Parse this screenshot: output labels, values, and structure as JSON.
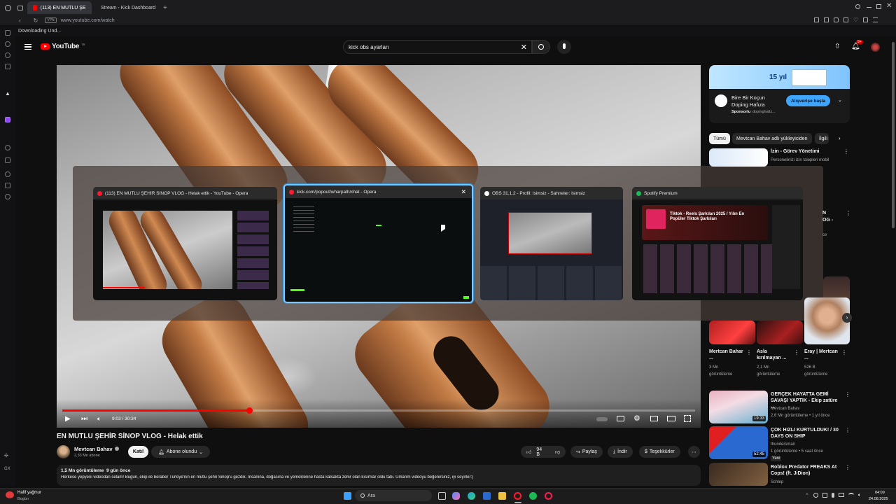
{
  "browser": {
    "tabs": [
      {
        "label": "(113) EN MUTLU ŞEHİR S…",
        "active": true,
        "color": "#ff0000"
      },
      {
        "label": "Stream - Kick Dashboard",
        "active": false,
        "color": "#53fc18"
      }
    ],
    "url": "www.youtube.com/watch",
    "vpn_badge": "VPN",
    "download_text": "Downloading Und..."
  },
  "youtube": {
    "logo_text": "YouTube",
    "logo_region": "TR",
    "search_value": "kick obs ayarları",
    "notification_count": "9+"
  },
  "player": {
    "time": "9:03 / 30:34",
    "progress_fraction": 0.296
  },
  "switcher": {
    "windows": [
      {
        "title": "(113) EN MUTLU ŞEHİR SİNOP VLOG - Helak ettik - YouTube - Opera",
        "active": false
      },
      {
        "title": "kick.com/popout/wharpath/chat - Opera",
        "active": true
      },
      {
        "title": "OBS 31.1.2 - Profil: İsimsiz - Sahneler: İsimsiz",
        "active": false
      },
      {
        "title": "Spotify Premium",
        "active": false
      }
    ],
    "spotify_heading": "Tiktok - Reels Şarkıları 2025 / Yılın En Popüler Tiktok Şarkıları"
  },
  "ad": {
    "banner_text": "15 yıl",
    "title": "Bire Bir Koçun Doping Hafıza",
    "sponsor_label": "Sponsorlu",
    "sponsor_domain": "dopinghafiz...",
    "cta": "Alışverişe başla"
  },
  "chips": [
    "Tümü",
    "Mevtcan Bahav adlı yükleyiciden",
    "İlgili"
  ],
  "sidebar_videos": [
    {
      "title": "İzin - Görev Yönetimi",
      "meta": "Personelinizi izin talepleri mobil"
    },
    {
      "title": "Mertcan Bahar ...",
      "meta1": "3 Mn",
      "meta2": "görüntüleme"
    },
    {
      "title": "Asla kırılmayan ...",
      "meta1": "2,1 Mn",
      "meta2": "görüntüleme"
    },
    {
      "title": "Eray | Mertcan ...",
      "meta1": "526 B",
      "meta2": "görüntüleme"
    },
    {
      "title": "GERÇEK HAYATTA GEMİ SAVAŞI YAPTIK - Ekip zatüre ...",
      "channel": "Mevtcan Bahav",
      "meta": "2,6 Mn görüntüleme • 1 yıl önce",
      "duration": "19:33"
    },
    {
      "title": "ÇOK HIZLI KURTULDUK! / 30 DAYS ON SHIP",
      "channel": "thundersman",
      "meta": "1 görüntüleme • 5 saat önce",
      "badge": "Yeni",
      "duration": "52:45"
    },
    {
      "title": "Roblox Predator FREAKS At Cops! (ft. JiDion)",
      "channel": "Schlep"
    }
  ],
  "partial_items": [
    "N",
    "OG -",
    "ce"
  ],
  "video": {
    "title": "EN MUTLU ŞEHİR SİNOP VLOG - Helak ettik",
    "channel": "Mevtcan Bahav",
    "subscribers": "2,33 Mn abone",
    "join": "Katıl",
    "subscribed": "Abone olundu",
    "likes": "94 B",
    "share": "Paylaş",
    "download": "İndir",
    "thanks": "Teşekkürler",
    "stats": "1,5 Mn görüntüleme  9 gün önce",
    "description": "Herkese yepyeni videodan selam! Bugün, ekip ile beraber Türkiye'nin en mutlu şehri Sinop'u gezdik. İnsanına, doğasına ve yemeklerine hasta kalsakta zehir olan kısımlar oldu tabi. Umarım videoyu beğenirsiniz, iyi seyirler:)"
  },
  "taskbar": {
    "weather_title": "Hafif yağmur",
    "weather_sub": "Bugün",
    "search_label": "Ara",
    "time": "04:09",
    "date": "24.08.2025"
  }
}
